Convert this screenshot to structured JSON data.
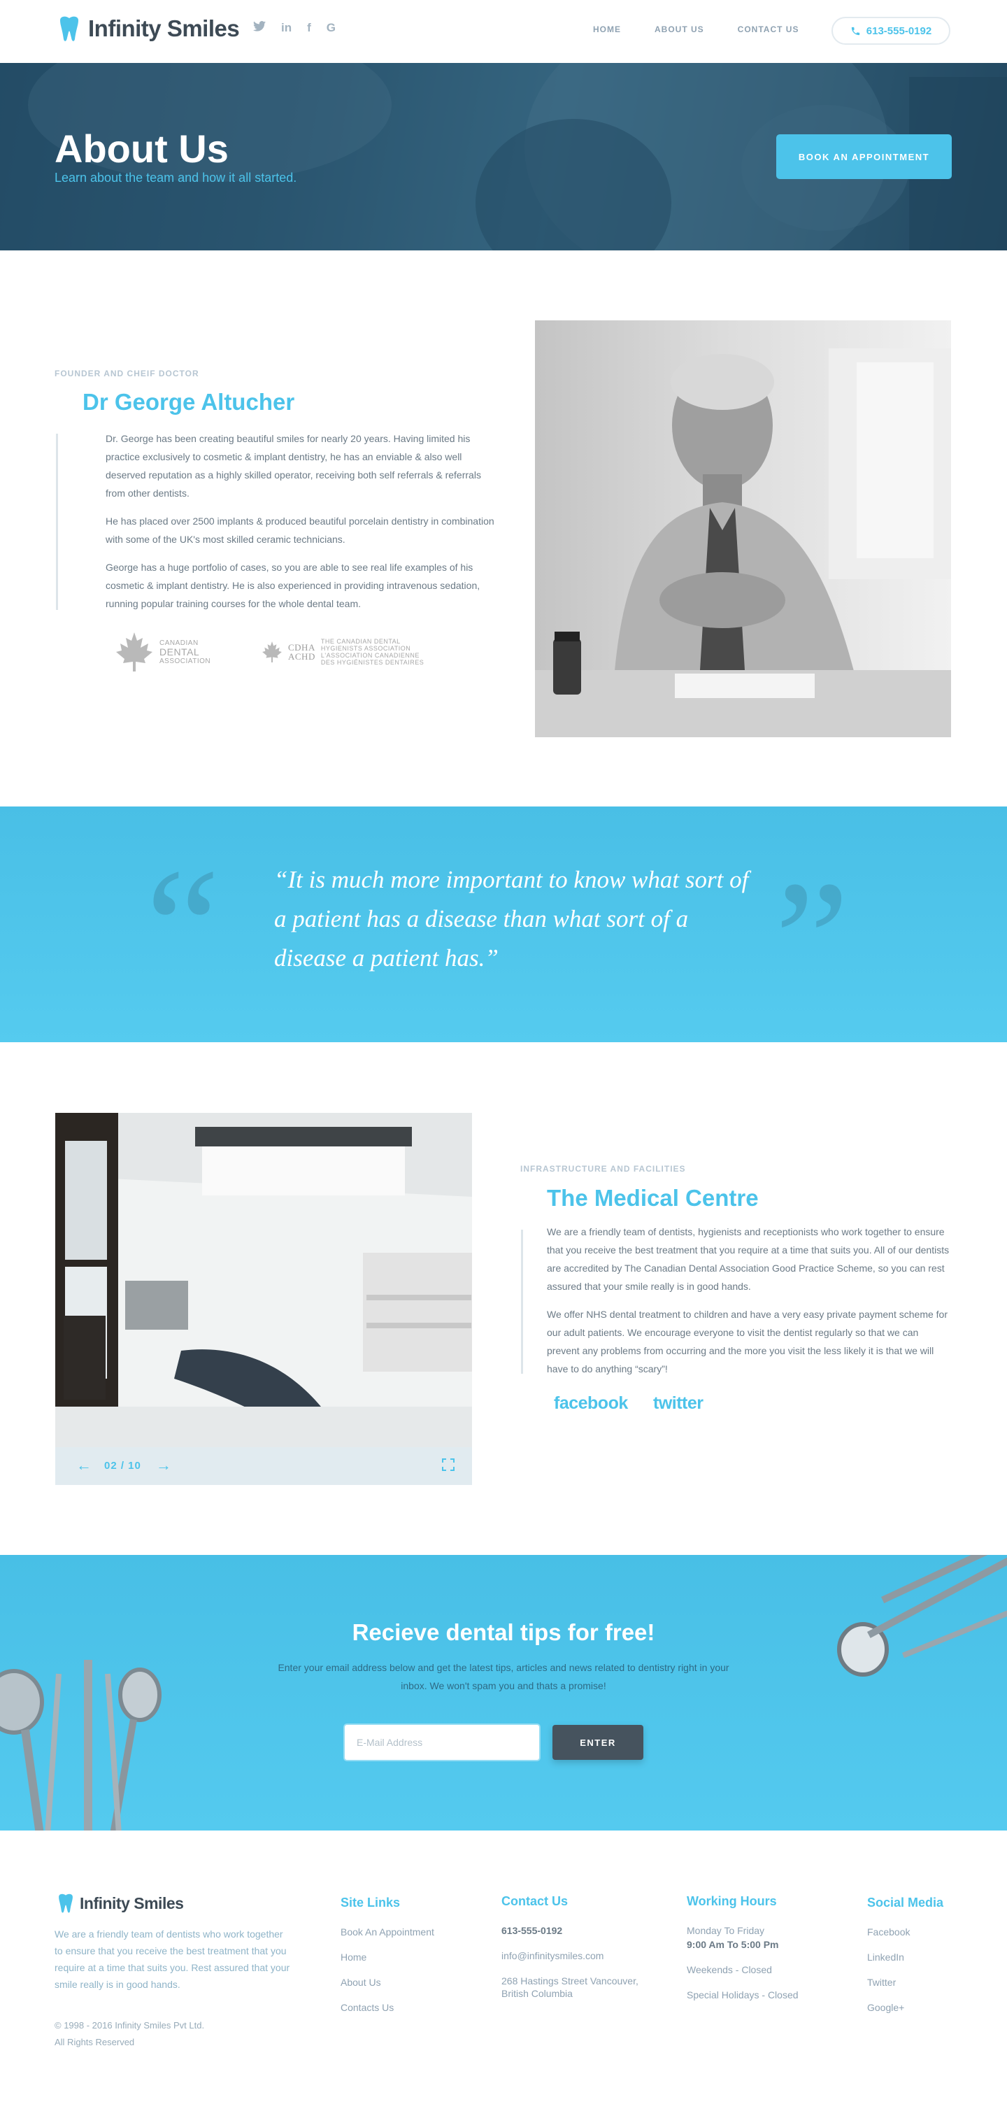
{
  "brand": {
    "name": "Infinity Smiles"
  },
  "header": {
    "nav": [
      "HOME",
      "ABOUT US",
      "CONTACT US"
    ],
    "phone": "613-555-0192"
  },
  "hero": {
    "title": "About Us",
    "subtitle": "Learn about the team and how it all started.",
    "cta": "BOOK AN APPOINTMENT"
  },
  "about": {
    "eyebrow": "FOUNDER AND CHEIF DOCTOR",
    "name": "Dr George Altucher",
    "paragraphs": [
      "Dr. George has been creating beautiful smiles for nearly 20 years. Having limited his practice exclusively to cosmetic & implant dentistry, he has an enviable & also well deserved reputation as a highly skilled operator, receiving both self referrals & referrals from other dentists.",
      "He has placed over 2500 implants & produced beautiful porcelain dentistry in combination with some of the UK's most skilled ceramic technicians.",
      "George has a huge portfolio of cases, so you are able to see real life examples of his cosmetic & implant dentistry. He is also experienced in providing intravenous sedation, running popular training courses for the whole dental team."
    ],
    "associations": [
      {
        "line1": "CANADIAN",
        "line2": "DENTAL",
        "line3": "ASSOCIATION"
      },
      {
        "abbr1": "CDHA",
        "abbr2": "ACHD",
        "line1": "THE CANADIAN DENTAL",
        "line2": "HYGIENISTS ASSOCIATION",
        "line3": "L'ASSOCIATION CANADIENNE",
        "line4": "DES HYGIÉNISTES DENTAIRES"
      }
    ]
  },
  "quote": {
    "text": "“It is much more important to know what sort of a patient has a disease than what sort of a disease a patient has.”",
    "open_mark": "“",
    "close_mark": "”"
  },
  "medical": {
    "eyebrow": "INFRASTRUCTURE AND FACILITIES",
    "title": "The Medical Centre",
    "paragraphs": [
      "We are a friendly team of dentists, hygienists and receptionists who work together to ensure that you receive the best treatment that you require at a time that suits you. All of our dentists are accredited by The Canadian Dental Association Good Practice Scheme, so you can rest assured that your smile really is in good hands.",
      "We offer NHS dental treatment to children and have a very easy private payment scheme for our adult patients. We encourage everyone to visit the dentist regularly so that we can prevent any problems from occurring and the more you visit the less likely it is that we will have to do anything “scary”!"
    ],
    "gallery_counter": "02 / 10",
    "social_brands": [
      "facebook",
      "twitter"
    ]
  },
  "newsletter": {
    "title": "Recieve dental tips for free!",
    "text": "Enter your email address below and get the latest tips, articles and news related to dentistry right in your inbox. We won't spam you and thats a promise!",
    "placeholder": "E-Mail Address",
    "button": "ENTER"
  },
  "footer": {
    "about": "We are a friendly team of dentists who work together to ensure that you receive the best treatment that you require at a time that suits you. Rest assured that your smile really is in good hands.",
    "copyright_line1": "© 1998 - 2016 Infinity Smiles Pvt Ltd.",
    "copyright_line2": "All Rights Reserved",
    "site_links": {
      "title": "Site Links",
      "items": [
        "Book An Appointment",
        "Home",
        "About Us",
        "Contacts Us"
      ]
    },
    "contact": {
      "title": "Contact Us",
      "phone": "613-555-0192",
      "email": "info@infinitysmiles.com",
      "address": "268 Hastings Street Vancouver, British Columbia"
    },
    "hours": {
      "title": "Working Hours",
      "weekday_label": "Monday To Friday",
      "weekday_time": "9:00 Am To 5:00 Pm",
      "weekends": "Weekends - Closed",
      "holidays": "Special Holidays - Closed"
    },
    "social": {
      "title": "Social Media",
      "items": [
        "Facebook",
        "LinkedIn",
        "Twitter",
        "Google+"
      ]
    }
  },
  "colors": {
    "accent": "#4cc3ea",
    "dark": "#3d4a55",
    "button_dark": "#46535e"
  },
  "icons": [
    "tooth-icon",
    "twitter-icon",
    "linkedin-icon",
    "facebook-icon",
    "google-plus-icon",
    "phone-icon",
    "arrow-left-icon",
    "arrow-right-icon",
    "expand-icon"
  ]
}
